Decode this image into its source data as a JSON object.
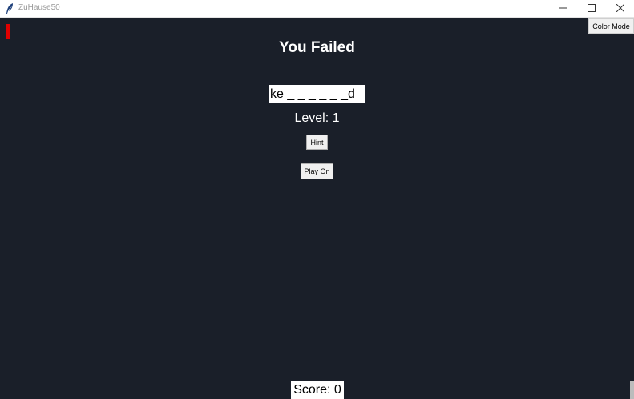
{
  "window": {
    "title": "ZuHause50",
    "icon": "feather-icon",
    "controls": [
      "minimize-icon",
      "maximize-icon",
      "close-icon"
    ]
  },
  "toolbar": {
    "color_mode_label": "Color Mode"
  },
  "game": {
    "status_heading": "You Failed",
    "word_display": "ke _ _ _ _ _ _d",
    "level_text": "Level: 1",
    "hint_label": "Hint",
    "play_on_label": "Play On",
    "score_text": "Score: 0"
  },
  "colors": {
    "background": "#1a1f29",
    "marker": "#e00000",
    "text": "#ffffff"
  }
}
